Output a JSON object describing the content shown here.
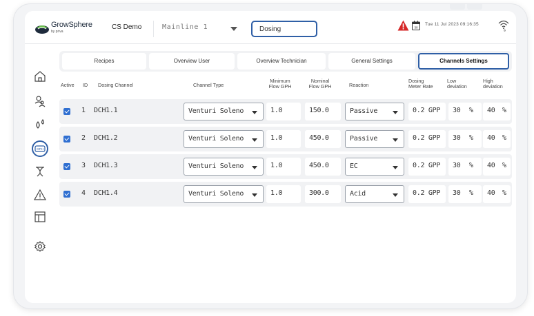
{
  "header": {
    "logo_text": "GrowSphere",
    "logo_sub": "by priva",
    "site_name": "CS Demo",
    "mainline_value": "Mainline 1",
    "dosing_value": "Dosing",
    "datetime": "Tue 11 Jul 2023  09:16:35",
    "wifi_badge": "9",
    "calendar_day": "30"
  },
  "sidebar": {
    "items": [
      {
        "icon": "home-icon"
      },
      {
        "icon": "users-icon"
      },
      {
        "icon": "droplets-icon"
      },
      {
        "icon": "gph-dosing-icon",
        "label": "GPH"
      },
      {
        "icon": "irrigation-icon"
      },
      {
        "icon": "alert-triangle-icon"
      },
      {
        "icon": "layout-icon"
      },
      {
        "icon": "settings-gear-icon"
      }
    ]
  },
  "tabs": [
    {
      "label": "Recipes"
    },
    {
      "label": "Overview User"
    },
    {
      "label": "Overview Technician"
    },
    {
      "label": "General Settings"
    },
    {
      "label": "Channels Settings"
    }
  ],
  "table": {
    "headers": {
      "active": "Active",
      "id": "ID",
      "dosing_channel": "Dosing Channel",
      "channel_type": "Channel Type",
      "min_flow_1": "Minimum",
      "min_flow_2": "Flow GPH",
      "nom_flow_1": "Nominal",
      "nom_flow_2": "Flow GPH",
      "reaction": "Reaction",
      "meter_rate_1": "Dosing",
      "meter_rate_2": "Meter Rate",
      "low_dev_1": "Low",
      "low_dev_2": "deviation",
      "high_dev_1": "High",
      "high_dev_2": "deviation"
    },
    "rows": [
      {
        "id": "1",
        "channel": "DCH1.1",
        "type": "Venturi Soleno",
        "min_flow": "1.0",
        "nom_flow": "150.0",
        "reaction": "Passive",
        "meter_rate": "0.2 GPP",
        "low_dev": "30",
        "high_dev": "40",
        "unit": "%"
      },
      {
        "id": "2",
        "channel": "DCH1.2",
        "type": "Venturi Soleno",
        "min_flow": "1.0",
        "nom_flow": "450.0",
        "reaction": "Passive",
        "meter_rate": "0.2 GPP",
        "low_dev": "30",
        "high_dev": "40",
        "unit": "%"
      },
      {
        "id": "3",
        "channel": "DCH1.3",
        "type": "Venturi Soleno",
        "min_flow": "1.0",
        "nom_flow": "450.0",
        "reaction": "EC",
        "meter_rate": "0.2 GPP",
        "low_dev": "30",
        "high_dev": "40",
        "unit": "%"
      },
      {
        "id": "4",
        "channel": "DCH1.4",
        "type": "Venturi Soleno",
        "min_flow": "1.0",
        "nom_flow": "300.0",
        "reaction": "Acid",
        "meter_rate": "0.2 GPP",
        "low_dev": "30",
        "high_dev": "40",
        "unit": "%"
      }
    ]
  },
  "colors": {
    "accent": "#2f5fa6",
    "checkbox": "#2f6fd1",
    "alert": "#d62828",
    "row_bg": "#f1f2f4"
  }
}
